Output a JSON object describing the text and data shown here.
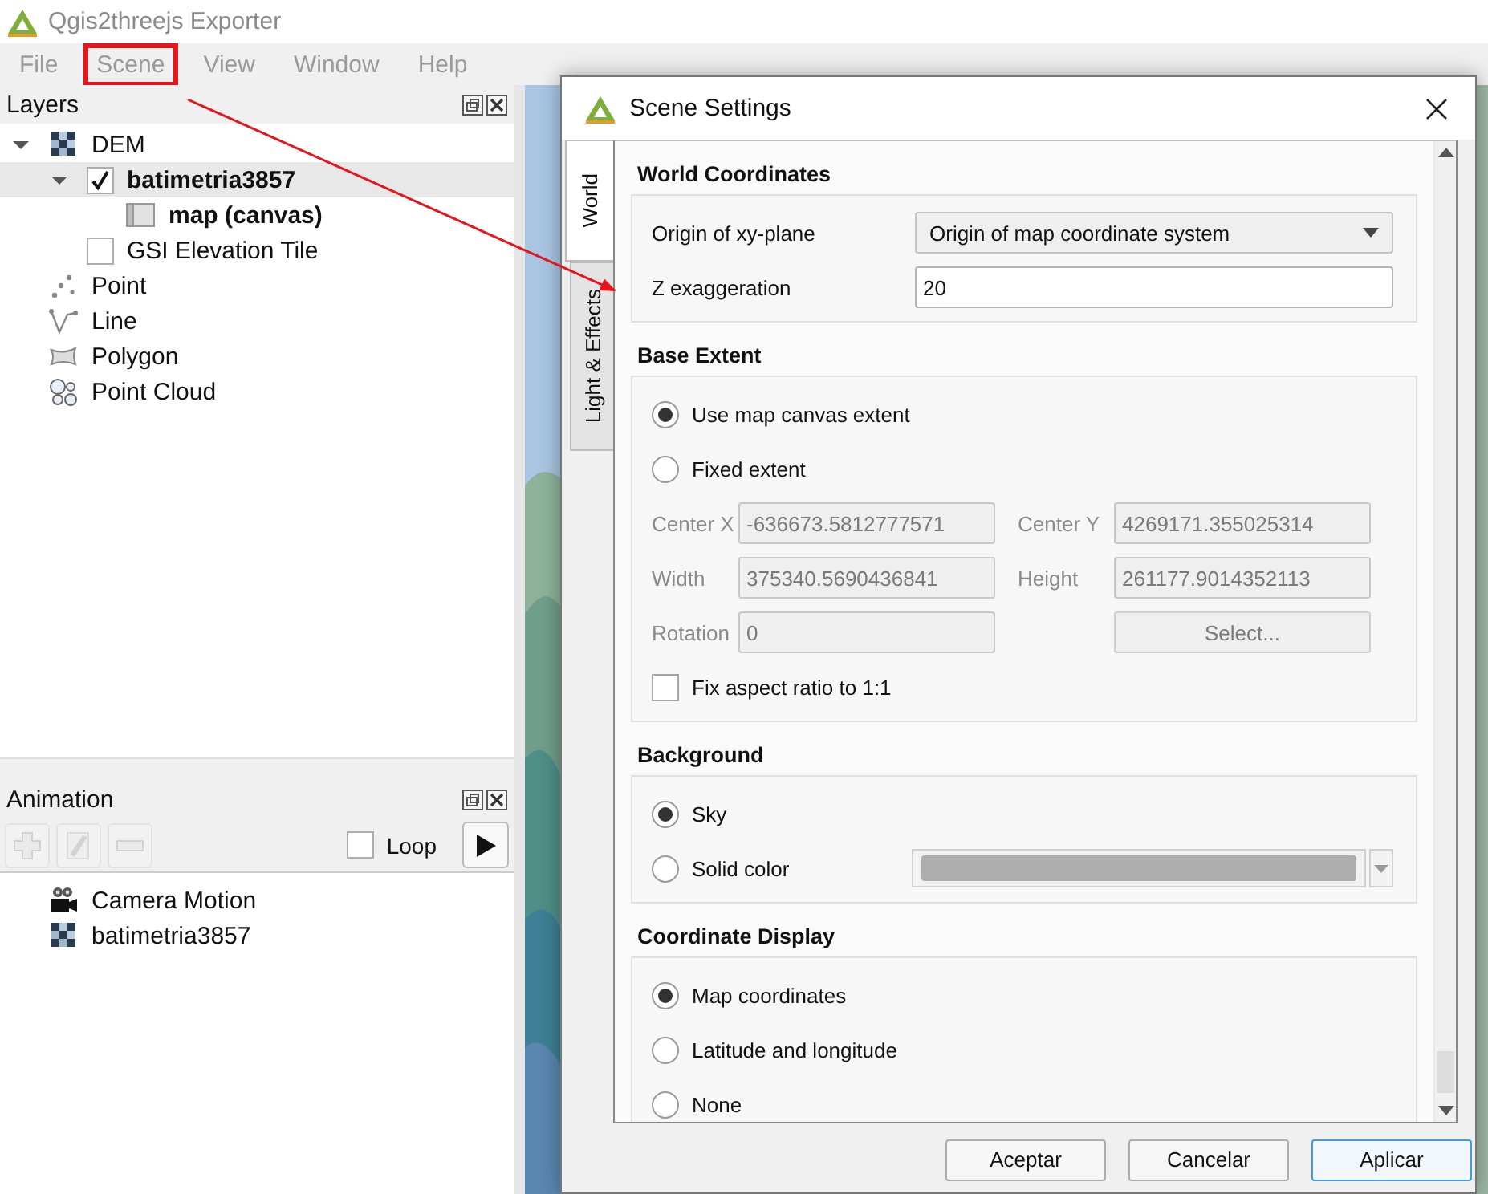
{
  "app": {
    "title": "Qgis2threejs Exporter"
  },
  "menu": [
    {
      "label": "File",
      "highlighted": false
    },
    {
      "label": "Scene",
      "highlighted": true
    },
    {
      "label": "View",
      "highlighted": false
    },
    {
      "label": "Window",
      "highlighted": false
    },
    {
      "label": "Help",
      "highlighted": false
    }
  ],
  "layers_panel": {
    "title": "Layers",
    "tree": [
      {
        "label": "DEM",
        "kind": "raster",
        "selected": false,
        "bold": false,
        "expanded": true,
        "children": [
          {
            "label": "batimetria3857",
            "kind": "check",
            "checked": true,
            "selected": true,
            "bold": true,
            "expanded": true,
            "children": [
              {
                "label": "map (canvas)",
                "kind": "canvas",
                "selected": false,
                "bold": true
              }
            ]
          },
          {
            "label": "GSI Elevation Tile",
            "kind": "check",
            "checked": false,
            "selected": false,
            "bold": false
          }
        ]
      },
      {
        "label": "Point",
        "kind": "point",
        "selected": false,
        "bold": false
      },
      {
        "label": "Line",
        "kind": "line",
        "selected": false,
        "bold": false
      },
      {
        "label": "Polygon",
        "kind": "polygon",
        "selected": false,
        "bold": false
      },
      {
        "label": "Point Cloud",
        "kind": "pointcloud",
        "selected": false,
        "bold": false
      }
    ]
  },
  "animation_panel": {
    "title": "Animation",
    "tools": [
      {
        "kind": "add",
        "disabled": true
      },
      {
        "kind": "edit",
        "disabled": true
      },
      {
        "kind": "remove",
        "disabled": true
      }
    ],
    "loop": {
      "label": "Loop",
      "checked": false
    },
    "items": [
      {
        "label": "Camera Motion",
        "kind": "camera"
      },
      {
        "label": "batimetria3857",
        "kind": "raster"
      }
    ]
  },
  "dialog": {
    "title": "Scene Settings",
    "tabs": [
      {
        "label": "World",
        "selected": true
      },
      {
        "label": "Light & Effects",
        "selected": false
      }
    ],
    "sections": [
      {
        "title": "World Coordinates",
        "rows": [
          {
            "kind": "combo",
            "label": "Origin of xy-plane",
            "value": "Origin of map coordinate system"
          },
          {
            "kind": "input",
            "label": "Z exaggeration",
            "value": "20"
          }
        ]
      },
      {
        "title": "Base Extent",
        "rows": [
          {
            "kind": "radio",
            "label": "Use map canvas extent",
            "selected": true
          },
          {
            "kind": "radio",
            "label": "Fixed extent",
            "selected": false
          },
          {
            "kind": "fields",
            "fields": [
              {
                "label": "Center X",
                "value": "-636673.5812777571",
                "disabled": true
              },
              {
                "label": "Center Y",
                "value": "4269171.355025314",
                "disabled": true
              }
            ]
          },
          {
            "kind": "fields",
            "fields": [
              {
                "label": "Width",
                "value": "375340.5690436841",
                "disabled": true
              },
              {
                "label": "Height",
                "value": "261177.9014352113",
                "disabled": true
              }
            ]
          },
          {
            "kind": "fields",
            "fields": [
              {
                "label": "Rotation",
                "value": "0",
                "disabled": true
              }
            ],
            "button": {
              "label": "Select...",
              "disabled": true
            }
          },
          {
            "kind": "checkbox",
            "label": "Fix aspect ratio to 1:1",
            "checked": false
          }
        ]
      },
      {
        "title": "Background",
        "rows": [
          {
            "kind": "radio",
            "label": "Sky",
            "selected": true
          },
          {
            "kind": "radio",
            "label": "Solid color",
            "selected": false,
            "color_button": {
              "disabled": true
            }
          }
        ]
      },
      {
        "title": "Coordinate Display",
        "rows": [
          {
            "kind": "radio",
            "label": "Map coordinates",
            "selected": true
          },
          {
            "kind": "radio",
            "label": "Latitude and longitude",
            "selected": false
          },
          {
            "kind": "radio",
            "label": "None",
            "selected": false
          }
        ]
      }
    ],
    "buttons": [
      {
        "label": "Aceptar",
        "default": false
      },
      {
        "label": "Cancelar",
        "default": false
      },
      {
        "label": "Aplicar",
        "default": true
      }
    ]
  },
  "annotation_arrow": true
}
